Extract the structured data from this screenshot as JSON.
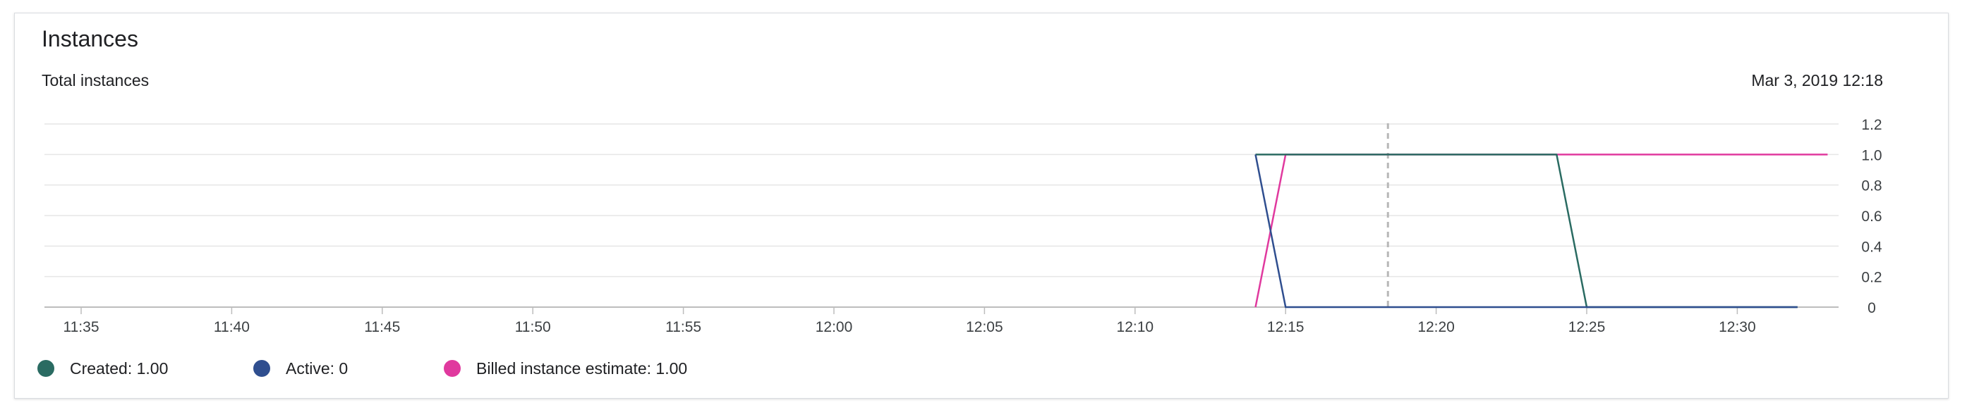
{
  "card": {
    "title": "Instances",
    "subtitle": "Total instances",
    "timestamp": "Mar 3, 2019 12:18"
  },
  "colors": {
    "created": "#2a6b62",
    "active": "#2f4e8f",
    "billed": "#e0399e",
    "grid": "#e6e6e6",
    "axis": "#bdbdbd",
    "cursor": "#b8b8b8",
    "tick_text": "#3c4043"
  },
  "legend": [
    {
      "key": "created",
      "label": "Created: 1.00"
    },
    {
      "key": "active",
      "label": "Active: 0"
    },
    {
      "key": "billed",
      "label": "Billed instance estimate: 1.00"
    }
  ],
  "chart_data": {
    "type": "line",
    "x_ticks": [
      "11:35",
      "11:40",
      "11:45",
      "11:50",
      "11:55",
      "12:00",
      "12:05",
      "12:10",
      "12:15",
      "12:20",
      "12:25",
      "12:30"
    ],
    "x_range": [
      "11:33",
      "12:33"
    ],
    "y_ticks": [
      0,
      0.2,
      0.4,
      0.6,
      0.8,
      1.0,
      1.2
    ],
    "ylim": [
      0,
      1.2
    ],
    "grid": true,
    "y_axis_side": "right",
    "cursor_x": "12:18",
    "series": [
      {
        "key": "created",
        "name": "Created",
        "points": [
          [
            "12:14",
            1.0
          ],
          [
            "12:24",
            1.0
          ],
          [
            "12:25",
            0
          ],
          [
            "12:32",
            0
          ]
        ]
      },
      {
        "key": "active",
        "name": "Active",
        "points": [
          [
            "12:14",
            1.0
          ],
          [
            "12:15",
            0
          ],
          [
            "12:32",
            0
          ]
        ]
      },
      {
        "key": "billed",
        "name": "Billed instance estimate",
        "points": [
          [
            "12:14",
            0
          ],
          [
            "12:15",
            1.0
          ],
          [
            "12:33",
            1.0
          ]
        ]
      }
    ]
  }
}
